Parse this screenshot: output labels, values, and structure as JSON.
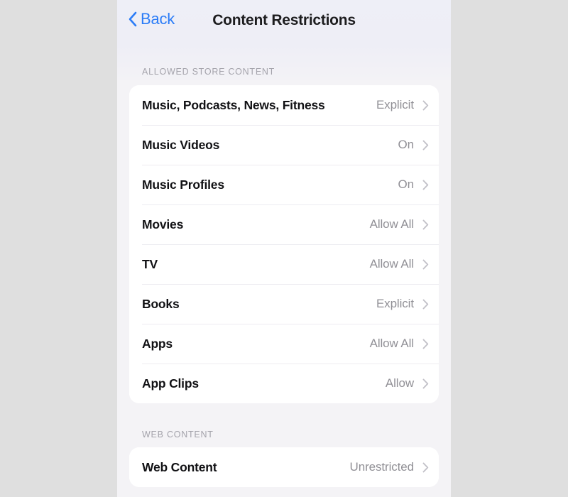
{
  "window": {
    "background_color": "#dfdfdf",
    "screen_background_color": "#f4f3f6"
  },
  "navbar": {
    "back_label": "Back",
    "back_icon": "chevron-left-icon",
    "title": "Content Restrictions",
    "accent_color": "#2b7cf7"
  },
  "sections": [
    {
      "header": "ALLOWED STORE CONTENT",
      "rows": [
        {
          "label": "Music, Podcasts, News, Fitness",
          "value": "Explicit",
          "chevron": "chevron-right-icon"
        },
        {
          "label": "Music Videos",
          "value": "On",
          "chevron": "chevron-right-icon"
        },
        {
          "label": "Music Profiles",
          "value": "On",
          "chevron": "chevron-right-icon"
        },
        {
          "label": "Movies",
          "value": "Allow All",
          "chevron": "chevron-right-icon"
        },
        {
          "label": "TV",
          "value": "Allow All",
          "chevron": "chevron-right-icon"
        },
        {
          "label": "Books",
          "value": "Explicit",
          "chevron": "chevron-right-icon"
        },
        {
          "label": "Apps",
          "value": "Allow All",
          "chevron": "chevron-right-icon"
        },
        {
          "label": "App Clips",
          "value": "Allow",
          "chevron": "chevron-right-icon"
        }
      ]
    },
    {
      "header": "WEB CONTENT",
      "rows": [
        {
          "label": "Web Content",
          "value": "Unrestricted",
          "chevron": "chevron-right-icon"
        }
      ]
    }
  ]
}
